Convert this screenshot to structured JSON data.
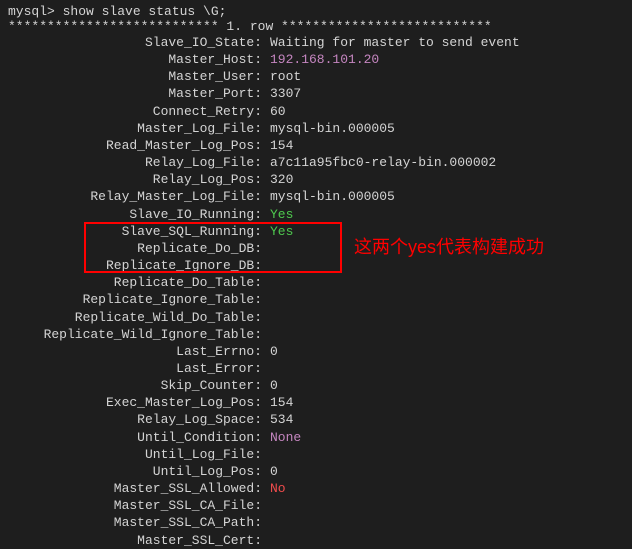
{
  "prompt": "mysql> show slave status \\G;",
  "row_header": "*************************** 1. row ***************************",
  "annotation": "这两个yes代表构建成功",
  "fields": [
    {
      "label": "Slave_IO_State:",
      "value": "Waiting for master to send event",
      "cls": "c-default"
    },
    {
      "label": "Master_Host:",
      "value": "192.168.101.20",
      "cls": "c-magenta"
    },
    {
      "label": "Master_User:",
      "value": "root",
      "cls": "c-default"
    },
    {
      "label": "Master_Port:",
      "value": "3307",
      "cls": "c-default"
    },
    {
      "label": "Connect_Retry:",
      "value": "60",
      "cls": "c-default"
    },
    {
      "label": "Master_Log_File:",
      "value": "mysql-bin.000005",
      "cls": "c-default"
    },
    {
      "label": "Read_Master_Log_Pos:",
      "value": "154",
      "cls": "c-default"
    },
    {
      "label": "Relay_Log_File:",
      "value": "a7c11a95fbc0-relay-bin.000002",
      "cls": "c-default"
    },
    {
      "label": "Relay_Log_Pos:",
      "value": "320",
      "cls": "c-default"
    },
    {
      "label": "Relay_Master_Log_File:",
      "value": "mysql-bin.000005",
      "cls": "c-default"
    },
    {
      "label": "Slave_IO_Running:",
      "value": "Yes",
      "cls": "c-green"
    },
    {
      "label": "Slave_SQL_Running:",
      "value": "Yes",
      "cls": "c-green"
    },
    {
      "label": "Replicate_Do_DB:",
      "value": "",
      "cls": "c-default"
    },
    {
      "label": "Replicate_Ignore_DB:",
      "value": "",
      "cls": "c-default"
    },
    {
      "label": "Replicate_Do_Table:",
      "value": "",
      "cls": "c-default"
    },
    {
      "label": "Replicate_Ignore_Table:",
      "value": "",
      "cls": "c-default"
    },
    {
      "label": "Replicate_Wild_Do_Table:",
      "value": "",
      "cls": "c-default"
    },
    {
      "label": "Replicate_Wild_Ignore_Table:",
      "value": "",
      "cls": "c-default"
    },
    {
      "label": "Last_Errno:",
      "value": "0",
      "cls": "c-default"
    },
    {
      "label": "Last_Error:",
      "value": "",
      "cls": "c-default"
    },
    {
      "label": "Skip_Counter:",
      "value": "0",
      "cls": "c-default"
    },
    {
      "label": "Exec_Master_Log_Pos:",
      "value": "154",
      "cls": "c-default"
    },
    {
      "label": "Relay_Log_Space:",
      "value": "534",
      "cls": "c-default"
    },
    {
      "label": "Until_Condition:",
      "value": "None",
      "cls": "c-magenta"
    },
    {
      "label": "Until_Log_File:",
      "value": "",
      "cls": "c-default"
    },
    {
      "label": "Until_Log_Pos:",
      "value": "0",
      "cls": "c-default"
    },
    {
      "label": "Master_SSL_Allowed:",
      "value": "No",
      "cls": "c-red"
    },
    {
      "label": "Master_SSL_CA_File:",
      "value": "",
      "cls": "c-default"
    },
    {
      "label": "Master_SSL_CA_Path:",
      "value": "",
      "cls": "c-default"
    },
    {
      "label": "Master_SSL_Cert:",
      "value": "",
      "cls": "c-default"
    }
  ]
}
